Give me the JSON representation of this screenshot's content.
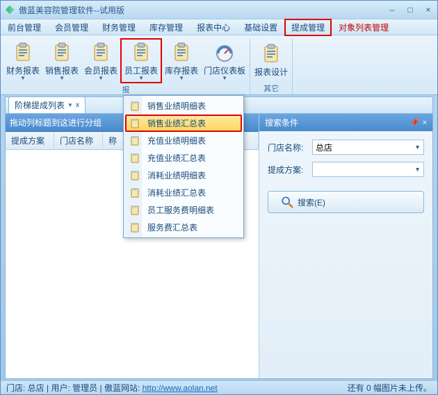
{
  "window": {
    "title": "傲蓝美容院管理软件--试用版"
  },
  "menus": [
    "前台管理",
    "会员管理",
    "财务管理",
    "库存管理",
    "报表中心",
    "基础设置",
    "提成管理",
    "对象列表管理"
  ],
  "menu_highlight_index": 6,
  "ribbon": {
    "buttons": [
      "财务报表",
      "销售报表",
      "会员报表",
      "员工报表",
      "库存报表",
      "门店仪表板",
      "报表设计"
    ],
    "highlight_index": 3,
    "group_left": "报",
    "group_right": "其它"
  },
  "dropdown": {
    "items": [
      "销售业绩明细表",
      "销售业绩汇总表",
      "充值业绩明细表",
      "充值业绩汇总表",
      "消耗业绩明细表",
      "消耗业绩汇总表",
      "员工服务费明细表",
      "服务费汇总表"
    ],
    "selected_index": 1
  },
  "tab": {
    "label": "阶梯提成列表",
    "close": "x"
  },
  "grid": {
    "group_hint": "拖动列标题到这进行分组",
    "cols": [
      "提成方案",
      "门店名称",
      "称"
    ]
  },
  "side": {
    "title": "搜索条件",
    "fields": {
      "store_label": "门店名称:",
      "store_value": "总店",
      "plan_label": "提成方案:",
      "plan_value": ""
    },
    "search_btn": "搜索(E)"
  },
  "status": {
    "left_store": "门店: 总店",
    "left_user": "用户: 管理员",
    "left_site": "傲蓝网站:",
    "url": "http://www.aolan.net",
    "right": "还有 0 幅图片未上传。"
  }
}
